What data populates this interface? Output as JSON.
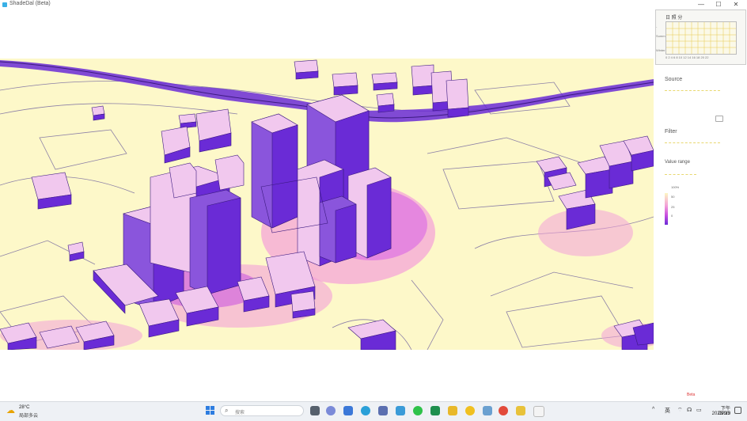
{
  "window": {
    "title": "ShadeDal (Beta)",
    "controls": [
      "—",
      "☐",
      "✕"
    ]
  },
  "panel": {
    "sun_card_title": "日 照 分",
    "sun_axis_labels": "0 2 4 6 8 10 12 14 16 18 20 22",
    "sun_side_labels": [
      "-",
      "Summ",
      "Winter"
    ],
    "source_label": "Source",
    "source_value": "",
    "source_rows": [
      "",
      ""
    ],
    "filter_label": "Filter",
    "value_range_label": "Value range",
    "legend_ticks": [
      "100%",
      "50",
      "25",
      "0"
    ],
    "beta_tag": "Beta"
  },
  "taskbar": {
    "weather_temp": "28°C",
    "weather_desc": "局部多云",
    "search_placeholder": "搜索",
    "tray_items": [
      "^",
      "英",
      "⌔",
      "☊",
      "▭"
    ],
    "clock_time": "下午 09:19",
    "clock_date": "2023/9/3"
  },
  "colors": {
    "ground": "#fdf8c9",
    "building_face": "#8a55dc",
    "building_side": "#6a2bd6",
    "building_top": "#f1c8ee",
    "shadow_strong": "#c94ee0",
    "shadow_mid": "#f3a0d8",
    "road": "#5a2bb0"
  }
}
